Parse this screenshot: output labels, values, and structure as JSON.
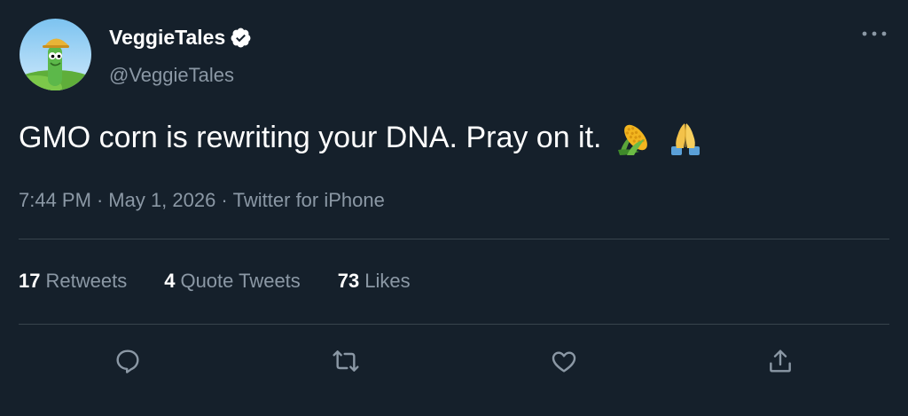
{
  "author": {
    "name": "VeggieTales",
    "handle": "@VeggieTales",
    "verified": true
  },
  "tweet": {
    "text": "GMO corn is rewriting your DNA. Pray on it.",
    "emojis": [
      "corn-emoji",
      "folded-hands-emoji"
    ]
  },
  "meta": {
    "time": "7:44 PM",
    "separator": "·",
    "date": "May 1, 2026",
    "source": "Twitter for iPhone"
  },
  "stats": {
    "retweets_count": "17",
    "retweets_label": "Retweets",
    "quotes_count": "4",
    "quotes_label": "Quote Tweets",
    "likes_count": "73",
    "likes_label": "Likes"
  },
  "actions": [
    "reply-icon",
    "retweet-icon",
    "like-icon",
    "share-icon"
  ],
  "colors": {
    "background": "#15202b",
    "text_primary": "#ffffff",
    "text_secondary": "#8b98a5",
    "divider": "#38444d"
  }
}
